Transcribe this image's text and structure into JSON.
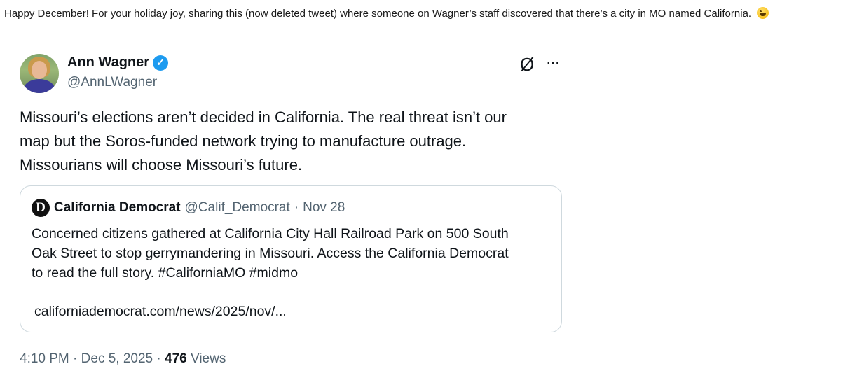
{
  "post": {
    "intro_text": "Happy December! For your holiday joy, sharing this (now deleted tweet) where someone on Wagner’s staff discovered that there’s a city in MO named California.",
    "emoji": "grinning-sweat-emoji"
  },
  "tweet": {
    "author_name": "Ann Wagner",
    "handle": "@AnnLWagner",
    "verified_icon": "✓",
    "grok_icon": "Ø",
    "more_icon": "···",
    "text_lines": [
      "Missouri’s elections aren’t decided in California. The real threat isn’t our",
      "map but the Soros-funded network trying to manufacture outrage.",
      "Missourians will choose Missouri’s future."
    ],
    "quote": {
      "logo": "D",
      "name": "California Democrat",
      "handle": "@Calif_Democrat",
      "separator": "·",
      "date": "Nov 28",
      "text_lines": [
        "Concerned citizens gathered at California City Hall Railroad Park on 500 South",
        "Oak Street to stop gerrymandering in Missouri. Access the California Democrat",
        "to read the full story. #CaliforniaMO #midmo"
      ],
      "link": "californiademocrat.com/news/2025/nov/..."
    },
    "time": "4:10 PM",
    "separator": "·",
    "date": "Dec 5, 2025",
    "views_count": "476",
    "views_label": "Views"
  },
  "colors": {
    "verified_blue": "#1d9bf0",
    "muted_text": "#536471",
    "primary_text": "#0f1419",
    "border": "#cfd9de"
  }
}
